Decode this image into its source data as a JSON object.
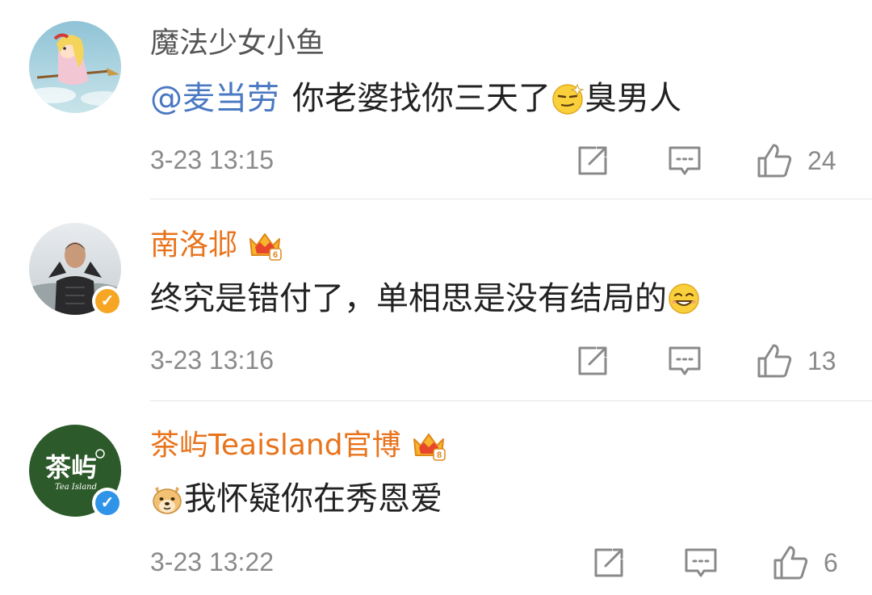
{
  "comments": [
    {
      "username": "魔法少女小鱼",
      "mention": "@麦当劳",
      "text_before_emoji": "你老婆找你三天了",
      "text_after_emoji": "臭男人",
      "time": "3-23 13:15",
      "likes": "24",
      "emoji_icon": "sly-face-emoji",
      "badge": "none"
    },
    {
      "username": "南洛邶",
      "text_before_emoji": "终究是错付了，单相思是没有结局的",
      "time": "3-23 13:16",
      "likes": "13",
      "emoji_icon": "grin-face-emoji",
      "badge": "gold-verified",
      "crown_level": "6"
    },
    {
      "username": "茶屿Teaisland官博",
      "text_after_emoji": "我怀疑你在秀恩爱",
      "time": "3-23 13:22",
      "likes": "6",
      "emoji_icon": "doge-emoji",
      "badge": "blue-verified",
      "crown_level": "8",
      "avatar_text": "茶屿",
      "avatar_subtext": "Tea Island"
    }
  ],
  "colors": {
    "username_orange": "#e8731c",
    "mention_blue": "#4a78c2",
    "meta_gray": "#8a8a8a",
    "avatar_green": "#2d5a2a"
  }
}
